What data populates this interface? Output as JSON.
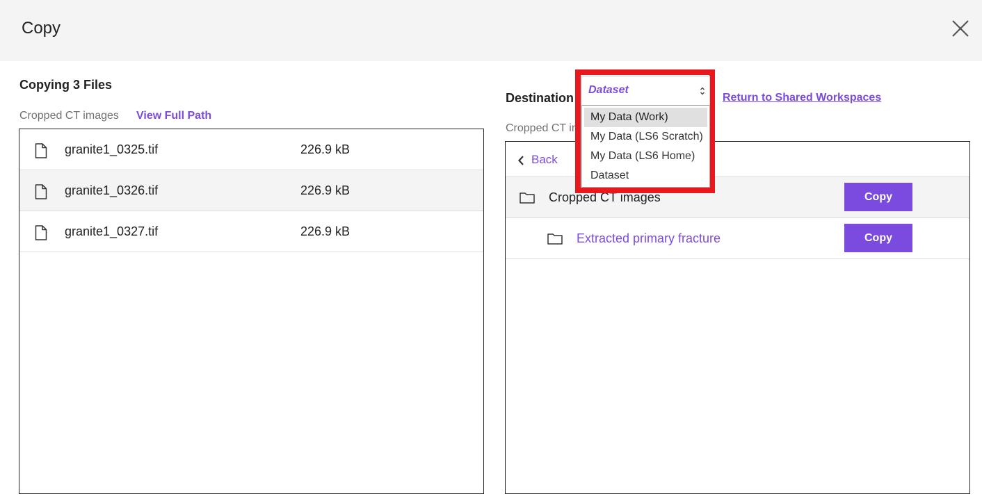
{
  "dialog": {
    "title": "Copy",
    "close_icon": "close-icon"
  },
  "source": {
    "heading": "Copying 3 Files",
    "path": "Cropped CT images",
    "view_full_path": "View Full Path",
    "files": [
      {
        "name": "granite1_0325.tif",
        "size": "226.9 kB",
        "icon": "file-icon"
      },
      {
        "name": "granite1_0326.tif",
        "size": "226.9 kB",
        "icon": "file-icon"
      },
      {
        "name": "granite1_0327.tif",
        "size": "226.9 kB",
        "icon": "file-icon"
      }
    ]
  },
  "destination": {
    "label": "Destination",
    "select_value": "Dataset",
    "options": [
      "My Data (Work)",
      "My Data (LS6 Scratch)",
      "My Data (LS6 Home)",
      "Dataset"
    ],
    "return_link": "Return to Shared Workspaces",
    "path": "Cropped CT im",
    "back_label": "Back",
    "folders": [
      {
        "name": "Cropped CT images",
        "copy_label": "Copy",
        "icon": "folder-icon"
      },
      {
        "name": "Extracted primary fracture",
        "copy_label": "Copy",
        "icon": "folder-icon"
      }
    ]
  },
  "colors": {
    "accent": "#7b4be0",
    "highlight": "#e8181c",
    "header_bg": "#f4f4f4"
  }
}
